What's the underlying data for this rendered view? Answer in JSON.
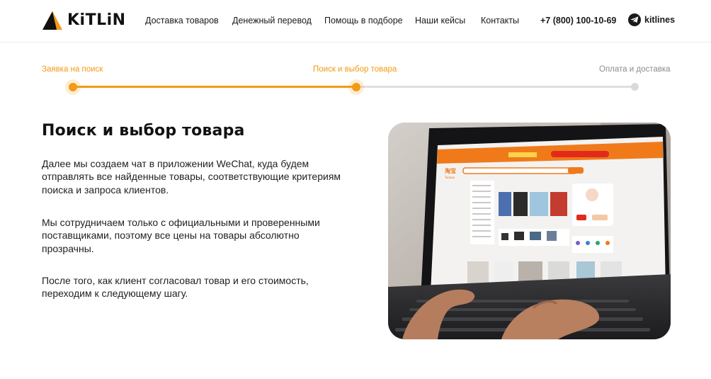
{
  "header": {
    "logo_text": "KiTLiN",
    "brand_color": "#f39a15",
    "nav": [
      {
        "label": "Доставка товаров"
      },
      {
        "label": "Денежный перевод"
      },
      {
        "label": "Помощь в подборе"
      },
      {
        "label": "Наши кейсы"
      },
      {
        "label": "Контакты"
      }
    ],
    "phone": "+7 (800) 100-10-69",
    "telegram": {
      "icon": "telegram-icon",
      "label": "kitlines"
    }
  },
  "steps": [
    {
      "label": "Заявка на поиск",
      "state": "done"
    },
    {
      "label": "Поиск и выбор товара",
      "state": "current"
    },
    {
      "label": "Оплата и доставка",
      "state": "upcoming"
    }
  ],
  "section": {
    "title": "Поиск и выбор товара",
    "paragraphs": [
      "Далее мы создаем чат в приложении WeChat, куда будем отправлять все найденные товары, соответствующие критериям поиска и запроса клиентов.",
      "Мы сотрудничаем только с официальными и проверенными поставщиками, поэтому все цены на товары абсолютно прозрачны.",
      "После того, как клиент согласовал товар и его стоимость, переходим к следующему шагу."
    ]
  },
  "photo": {
    "screen_brand": "淘宝",
    "screen_brand_sub": "Taobao"
  }
}
